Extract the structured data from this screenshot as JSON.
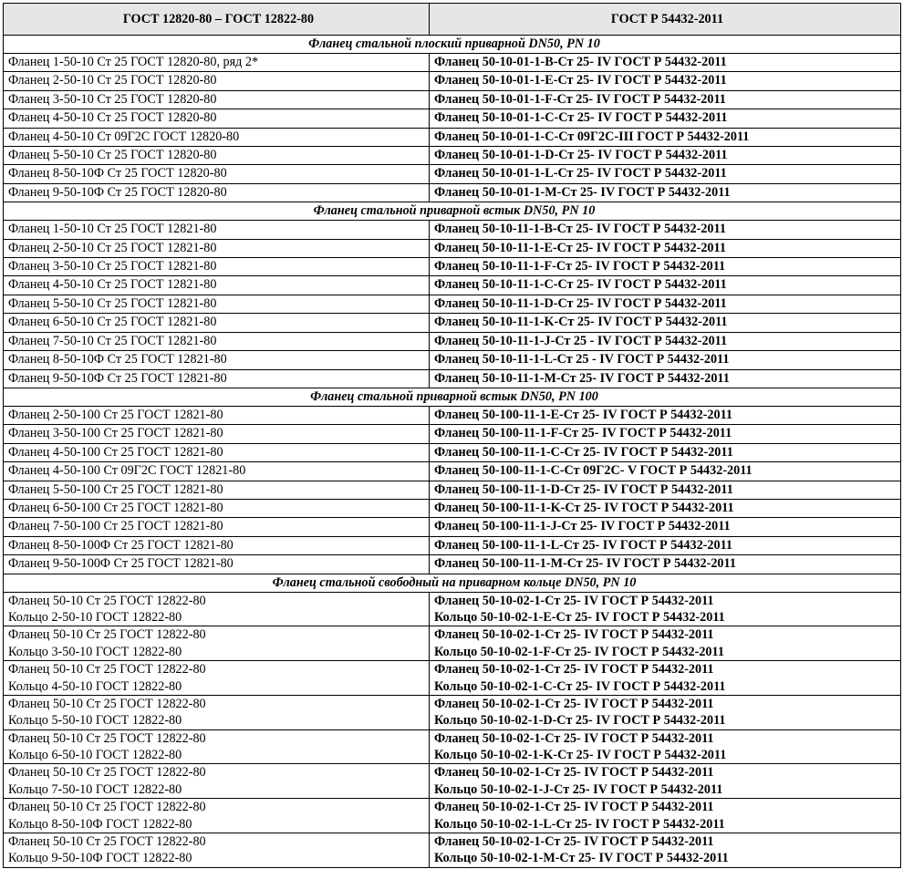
{
  "header": {
    "left": "ГОСТ 12820-80 – ГОСТ 12822-80",
    "right": "ГОСТ Р 54432-2011"
  },
  "sections": [
    {
      "title": "Фланец стальной плоский приварной DN50, PN 10",
      "rows": [
        {
          "left": "Фланец 1-50-10 Ст 25 ГОСТ 12820-80, ряд 2*",
          "right": "Фланец 50-10-01-1-B-Ст 25- IV ГОСТ Р 54432-2011"
        },
        {
          "left": "Фланец 2-50-10 Ст 25 ГОСТ 12820-80",
          "right": "Фланец 50-10-01-1-E-Ст 25- IV ГОСТ Р 54432-2011"
        },
        {
          "left": "Фланец 3-50-10 Ст 25 ГОСТ 12820-80",
          "right": "Фланец 50-10-01-1-F-Ст 25- IV ГОСТ Р 54432-2011"
        },
        {
          "left": "Фланец 4-50-10 Ст 25 ГОСТ 12820-80",
          "right": "Фланец 50-10-01-1-C-Ст 25- IV ГОСТ Р 54432-2011"
        },
        {
          "left": "Фланец 4-50-10 Ст 09Г2С ГОСТ 12820-80",
          "right": "Фланец 50-10-01-1-C-Ст 09Г2С-III  ГОСТ Р 54432-2011"
        },
        {
          "left": "Фланец 5-50-10 Ст 25 ГОСТ 12820-80",
          "right": "Фланец 50-10-01-1-D-Ст 25- IV ГОСТ Р 54432-2011"
        },
        {
          "left": "Фланец 8-50-10Ф Ст 25 ГОСТ 12820-80",
          "right": "Фланец 50-10-01-1-L-Ст 25- IV ГОСТ Р 54432-2011"
        },
        {
          "left": "Фланец 9-50-10Ф Ст 25 ГОСТ 12820-80",
          "right": "Фланец 50-10-01-1-M-Ст 25- IV ГОСТ Р 54432-2011"
        }
      ]
    },
    {
      "title": "Фланец стальной приварной встык DN50,  PN 10",
      "rows": [
        {
          "left": "Фланец 1-50-10 Ст 25 ГОСТ 12821-80",
          "right": "Фланец 50-10-11-1-B-Ст 25- IV ГОСТ Р 54432-2011"
        },
        {
          "left": "Фланец 2-50-10 Ст 25 ГОСТ 12821-80",
          "right": "Фланец 50-10-11-1-E-Ст 25- IV ГОСТ Р 54432-2011"
        },
        {
          "left": "Фланец 3-50-10 Ст 25 ГОСТ 12821-80",
          "right": "Фланец 50-10-11-1-F-Ст 25- IV ГОСТ Р 54432-2011"
        },
        {
          "left": "Фланец 4-50-10 Ст 25 ГОСТ 12821-80",
          "right": "Фланец 50-10-11-1-C-Ст 25- IV ГОСТ Р 54432-2011"
        },
        {
          "left": "Фланец 5-50-10 Ст 25 ГОСТ 12821-80",
          "right": "Фланец 50-10-11-1-D-Ст 25- IV ГОСТ Р 54432-2011"
        },
        {
          "left": "Фланец 6-50-10 Ст 25 ГОСТ 12821-80",
          "right": "Фланец 50-10-11-1-K-Ст 25- IV ГОСТ Р 54432-2011"
        },
        {
          "left": "Фланец 7-50-10 Ст 25 ГОСТ 12821-80",
          "right": "Фланец 50-10-11-1-J-Ст 25 - IV ГОСТ Р 54432-2011"
        },
        {
          "left": "Фланец 8-50-10Ф Ст 25 ГОСТ 12821-80",
          "right": "Фланец 50-10-11-1-L-Ст 25 - IV ГОСТ Р 54432-2011"
        },
        {
          "left": "Фланец 9-50-10Ф Ст 25 ГОСТ 12821-80",
          "right": "Фланец 50-10-11-1-M-Ст 25- IV ГОСТ Р 54432-2011"
        }
      ]
    },
    {
      "title": "Фланец стальной приварной встык DN50,  PN 100",
      "rows": [
        {
          "left": "Фланец 2-50-100 Ст 25 ГОСТ 12821-80",
          "right": "Фланец 50-100-11-1-E-Ст 25- IV ГОСТ Р 54432-2011"
        },
        {
          "left": "Фланец 3-50-100 Ст 25 ГОСТ 12821-80",
          "right": "Фланец 50-100-11-1-F-Ст 25- IV ГОСТ Р 54432-2011"
        },
        {
          "left": "Фланец 4-50-100 Ст 25 ГОСТ 12821-80",
          "right": "Фланец 50-100-11-1-C-Ст 25- IV ГОСТ Р 54432-2011"
        },
        {
          "left": "Фланец 4-50-100 Ст 09Г2С ГОСТ 12821-80",
          "right": "Фланец 50-100-11-1-C-Ст 09Г2С- V ГОСТ Р 54432-2011"
        },
        {
          "left": "Фланец 5-50-100 Ст 25 ГОСТ 12821-80",
          "right": "Фланец 50-100-11-1-D-Ст 25- IV ГОСТ Р 54432-2011"
        },
        {
          "left": "Фланец 6-50-100 Ст 25 ГОСТ 12821-80",
          "right": "Фланец 50-100-11-1-K-Ст 25- IV ГОСТ Р 54432-2011"
        },
        {
          "left": "Фланец 7-50-100 Ст 25 ГОСТ 12821-80",
          "right": "Фланец 50-100-11-1-J-Ст 25- IV ГОСТ Р 54432-2011"
        },
        {
          "left": "Фланец 8-50-100Ф Ст 25 ГОСТ 12821-80",
          "right": "Фланец 50-100-11-1-L-Ст 25- IV ГОСТ Р 54432-2011"
        },
        {
          "left": "Фланец 9-50-100Ф Ст 25 ГОСТ 12821-80",
          "right": "Фланец 50-100-11-1-M-Ст 25- IV ГОСТ Р 54432-2011"
        }
      ]
    },
    {
      "title": "Фланец стальной свободный на приварном кольце  DN50,  PN 10",
      "pairs": [
        {
          "left1": "Фланец 50-10 Ст 25 ГОСТ 12822-80",
          "left2": "Кольцо  2-50-10 ГОСТ 12822-80",
          "right1": "Фланец 50-10-02-1-Ст 25- IV ГОСТ Р 54432-2011",
          "right2": "Кольцо 50-10-02-1-E-Ст 25- IV ГОСТ Р 54432-2011"
        },
        {
          "left1": "Фланец 50-10 Ст 25 ГОСТ 12822-80",
          "left2": "Кольцо  3-50-10 ГОСТ 12822-80",
          "right1": "Фланец 50-10-02-1-Ст 25- IV ГОСТ Р 54432-2011",
          "right2": "Кольцо 50-10-02-1-F-Ст 25- IV ГОСТ Р 54432-2011"
        },
        {
          "left1": "Фланец 50-10 Ст 25 ГОСТ 12822-80",
          "left2": "Кольцо  4-50-10 ГОСТ 12822-80",
          "right1": "Фланец 50-10-02-1-Ст 25- IV ГОСТ Р 54432-2011",
          "right2": "Кольцо 50-10-02-1-C-Ст 25- IV ГОСТ Р 54432-2011"
        },
        {
          "left1": "Фланец 50-10 Ст 25 ГОСТ 12822-80",
          "left2": "Кольцо  5-50-10 ГОСТ 12822-80",
          "right1": "Фланец 50-10-02-1-Ст 25- IV ГОСТ Р 54432-2011",
          "right2": "Кольцо 50-10-02-1-D-Ст 25- IV ГОСТ Р 54432-2011"
        },
        {
          "left1": "Фланец 50-10 Ст 25 ГОСТ 12822-80",
          "left2": "Кольцо  6-50-10 ГОСТ 12822-80",
          "right1": "Фланец 50-10-02-1-Ст 25- IV ГОСТ Р 54432-2011",
          "right2": "Кольцо 50-10-02-1-K-Ст 25- IV ГОСТ Р 54432-2011"
        },
        {
          "left1": "Фланец 50-10 Ст 25 ГОСТ 12822-80",
          "left2": "Кольцо  7-50-10 ГОСТ 12822-80",
          "right1": "Фланец 50-10-02-1-Ст 25- IV ГОСТ Р 54432-2011",
          "right2": "Кольцо 50-10-02-1-J-Ст 25- IV ГОСТ Р 54432-2011"
        },
        {
          "left1": "Фланец 50-10 Ст 25 ГОСТ 12822-80",
          "left2": "Кольцо  8-50-10Ф ГОСТ 12822-80",
          "right1": "Фланец 50-10-02-1-Ст 25- IV ГОСТ Р 54432-2011",
          "right2": "Кольцо 50-10-02-1-L-Ст 25- IV ГОСТ Р 54432-2011"
        },
        {
          "left1": "Фланец 50-10 Ст 25 ГОСТ 12822-80",
          "left2": "Кольцо  9-50-10Ф ГОСТ 12822-80",
          "right1": "Фланец 50-10-02-1-Ст 25- IV ГОСТ Р 54432-2011",
          "right2": "Кольцо 50-10-02-1-M-Ст 25- IV ГОСТ Р 54432-2011"
        }
      ]
    }
  ]
}
